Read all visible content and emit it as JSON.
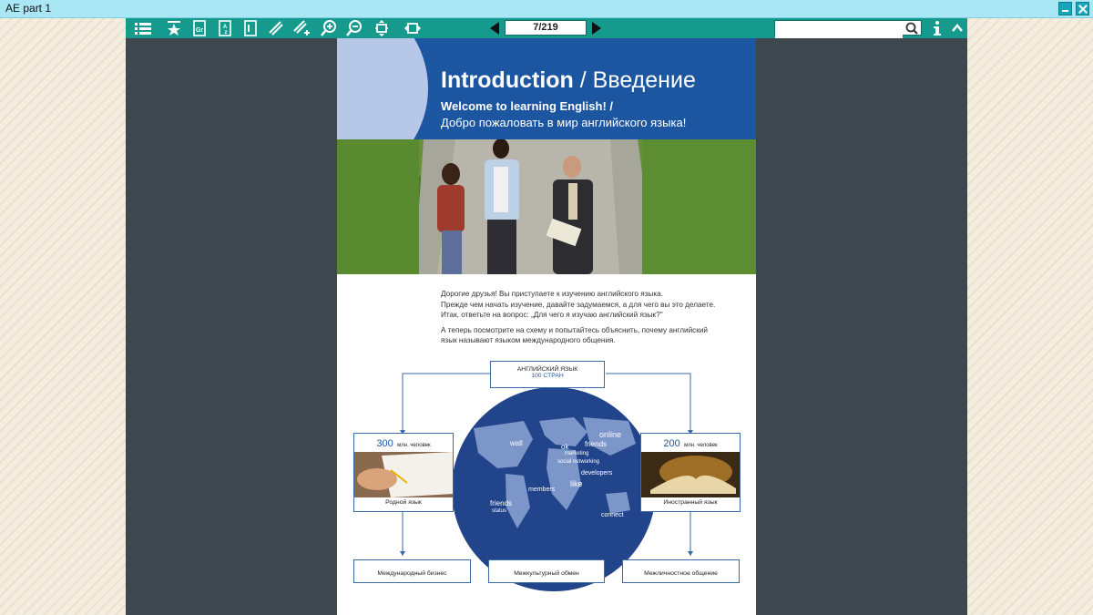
{
  "window": {
    "title": "AE part 1"
  },
  "toolbar": {
    "icons": [
      "toc-list-icon",
      "bookmark-star-icon",
      "grammar-icon",
      "dictionary-az-icon",
      "notes-book-icon",
      "highlighter-icon",
      "add-highlight-icon",
      "zoom-in-icon",
      "zoom-out-icon",
      "fit-height-icon",
      "fit-width-icon"
    ],
    "page_indicator": "7/219",
    "search_value": "",
    "accent": "#179a8e"
  },
  "page": {
    "header": {
      "title_en": "Introduction",
      "title_sep": " / ",
      "title_ru": "Введение",
      "subtitle_en": "Welcome to learning English! /",
      "subtitle_ru": "Добро пожаловать в мир английского языка!",
      "bg_color": "#1d56a0"
    },
    "intro": {
      "p1_l1": "Дорогие друзья! Вы приступаете к изучению английского языка.",
      "p1_l2": "Прежде чем начать изучение, давайте задумаемся, а для чего вы это делаете.",
      "p1_l3": "Итак, ответьте на вопрос: „Для чего я изучаю английский язык?\"",
      "p2_l1": "А теперь посмотрите на схему и попытайтесь объяснить, почему английский",
      "p2_l2": "язык называют языком международного общения."
    },
    "diagram": {
      "top_box": {
        "title": "АНГЛИЙСКИЙ ЯЗЫК",
        "sub": "100 СТРАН"
      },
      "left_box": {
        "num": "300",
        "unit": "млн. человек",
        "caption": "Родной язык"
      },
      "right_box": {
        "num": "200",
        "unit": "млн. человек",
        "caption": "Иностранный язык"
      },
      "bottom_left": "Международный бизнес",
      "bottom_center": "Межкультурный обмен",
      "bottom_right": "Межличностное общение",
      "word_cloud": [
        "online",
        "wall",
        "ok",
        "friends",
        "marketing",
        "social networking",
        "developers",
        "like",
        "members",
        "friends",
        "status",
        "connect"
      ]
    }
  }
}
